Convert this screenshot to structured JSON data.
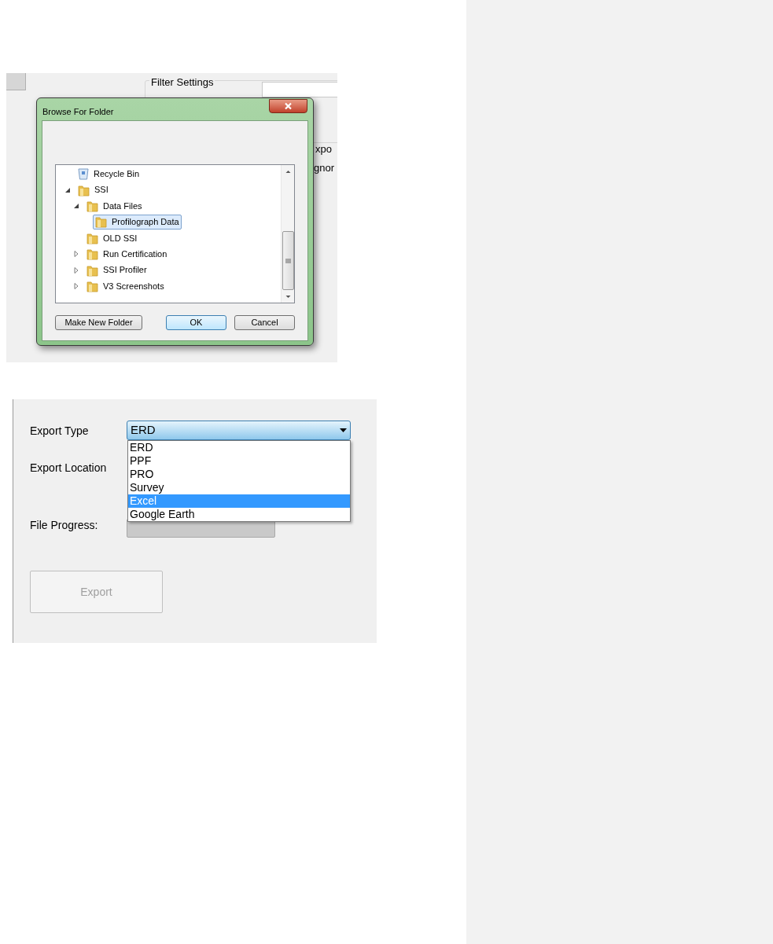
{
  "browse_screenshot": {
    "background": {
      "group_title": "Filter Settings",
      "label_1": "xpo",
      "label_2": "gnor"
    },
    "dialog": {
      "title": "Browse For Folder",
      "tree": [
        {
          "label": "Recycle Bin",
          "kind": "bin",
          "selected": false
        },
        {
          "label": "SSI",
          "kind": "folder",
          "selected": false,
          "expanded": true,
          "children": [
            {
              "label": "Data Files",
              "kind": "folder",
              "selected": false,
              "expanded": true,
              "children": [
                {
                  "label": "Profilograph Data",
                  "kind": "folder",
                  "selected": true
                }
              ]
            },
            {
              "label": "OLD SSI",
              "kind": "folder",
              "selected": false
            },
            {
              "label": "Run Certification",
              "kind": "folder",
              "selected": false,
              "expanded": false
            },
            {
              "label": "SSI Profiler",
              "kind": "folder",
              "selected": false,
              "expanded": false
            },
            {
              "label": "V3 Screenshots",
              "kind": "folder",
              "selected": false,
              "expanded": false
            }
          ]
        }
      ],
      "buttons": [
        {
          "label": "Make New Folder",
          "default": false
        },
        {
          "label": "OK",
          "default": true
        },
        {
          "label": "Cancel",
          "default": false
        }
      ]
    }
  },
  "export_screenshot": {
    "export_type": {
      "label": "Export Type",
      "value": "ERD",
      "open": true,
      "options": [
        {
          "label": "ERD",
          "highlighted": false
        },
        {
          "label": "PPF",
          "highlighted": false
        },
        {
          "label": "PRO",
          "highlighted": false
        },
        {
          "label": "Survey",
          "highlighted": false
        },
        {
          "label": "Excel",
          "highlighted": true
        },
        {
          "label": "Google Earth",
          "highlighted": false
        }
      ]
    },
    "export_location": {
      "label": "Export Location"
    },
    "file_progress": {
      "label": "File Progress:",
      "level": 0
    },
    "export_button": {
      "label": "Export",
      "disabled": true
    }
  }
}
